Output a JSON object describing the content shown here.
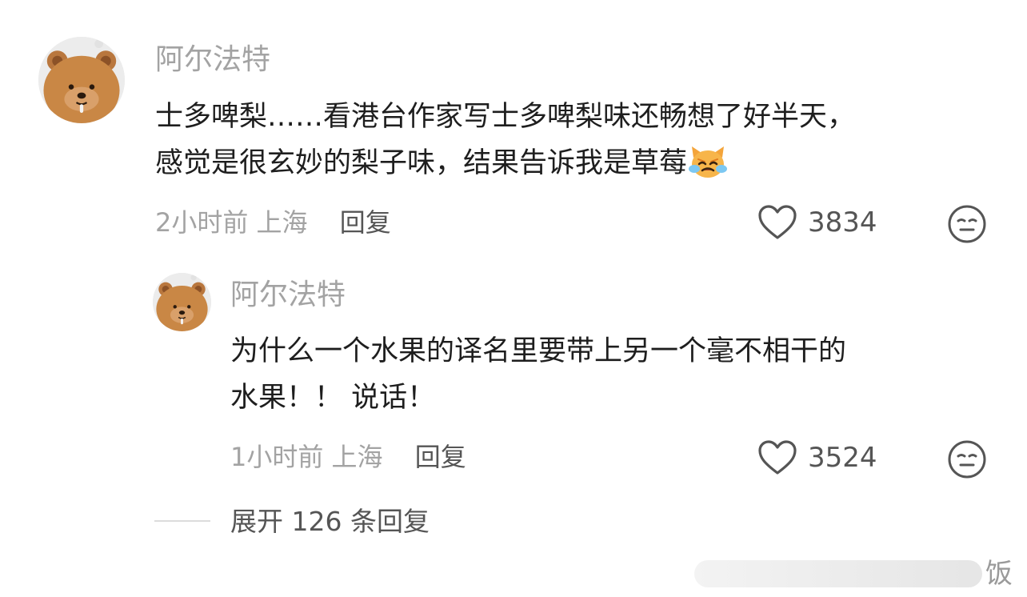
{
  "main_comment": {
    "username": "阿尔法特",
    "text_line1": "士多啤梨……看港台作家写士多啤梨味还畅想了好半天，",
    "text_line2": "感觉是很玄妙的梨子味，结果告诉我是草莓",
    "time": "2小时前",
    "location": "上海",
    "reply_label": "回复",
    "like_count": "3834"
  },
  "reply_comment": {
    "username": "阿尔法特",
    "text_line1": "为什么一个水果的译名里要带上另一个毫不相干的",
    "text_line2": "水果！！ 说话！",
    "time": "1小时前",
    "location": "上海",
    "reply_label": "回复",
    "like_count": "3524"
  },
  "expand": {
    "label": "展开 126 条回复"
  },
  "watermark": {
    "text": "饭"
  },
  "icons": {
    "avatar": "bear-plush-avatar",
    "emoji": "crying-cat-emoji",
    "like": "heart-icon",
    "react": "neutral-face-icon"
  },
  "colors": {
    "username": "#a3a3a3",
    "body_text": "#1e1e1e",
    "meta_text": "#a3a3a3",
    "action_text": "#555555",
    "icon_stroke": "#555555"
  }
}
